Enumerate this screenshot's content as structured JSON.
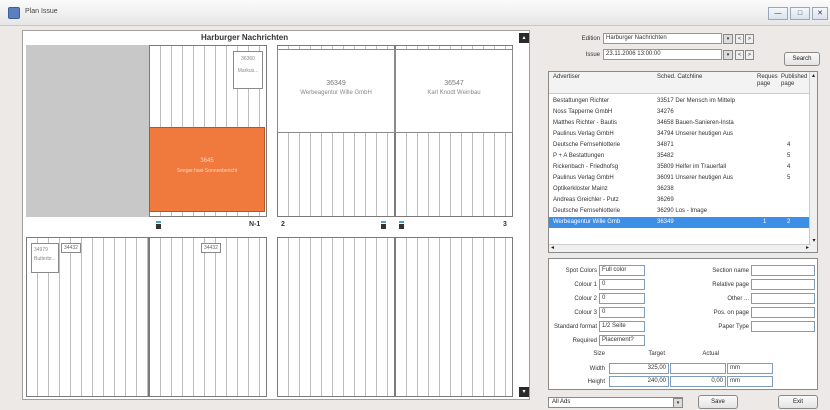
{
  "window": {
    "title": "Plan Issue",
    "controls": [
      "—",
      "□",
      "✕"
    ]
  },
  "layout": {
    "publication": "Harburger Nachrichten",
    "ads": {
      "ad1_num": "36349",
      "ad1_name": "Werbeagentur Wille GmbH",
      "ad2_num": "36547",
      "ad2_name": "Karl Knodt Weinbau",
      "orange_num": "3645",
      "orange_text": "Seeger.hasi-Sonnenbericht",
      "small_top_num": "36360",
      "small_top_text": "Markus...",
      "small_bl1_num": "34979",
      "small_bl1_text": "Butterbr...",
      "small_bl2": "34432",
      "small_bm": "34432"
    },
    "page_labels": {
      "p1": "N-1",
      "p2": "2",
      "p3": "3"
    }
  },
  "filters": {
    "edition_label": "Edition",
    "edition_value": "Harburger Nachrichten",
    "issue_label": "Issue",
    "issue_value": "23.11.2006 13:00:00",
    "search_label": "Search",
    "nav_prev": "<",
    "nav_next": ">",
    "dropdown_glyph": "▾"
  },
  "grid": {
    "headers": {
      "advertiser": "Advertiser",
      "sched": "Sched. Catchline",
      "requested": "Reques page",
      "published": "Published page"
    },
    "rows": [
      {
        "advertiser": "Bestattungen Richter",
        "sched": "33517 Der Mensch im Mittelp",
        "req": "",
        "pub": ""
      },
      {
        "advertiser": "Noss Tapperne GmbH",
        "sched": "34276",
        "req": "",
        "pub": ""
      },
      {
        "advertiser": "Matthes Richter - Bautis",
        "sched": "34658 Bauen-Sanieren-Insta",
        "req": "",
        "pub": ""
      },
      {
        "advertiser": "Paulinus Verlag GmbH",
        "sched": "34794 Unserer heutigen Aus",
        "req": "",
        "pub": ""
      },
      {
        "advertiser": "Deutsche Fernsehlotterie",
        "sched": "34871",
        "req": "",
        "pub": "4"
      },
      {
        "advertiser": "P + A Bestattungen",
        "sched": "35482",
        "req": "",
        "pub": "5"
      },
      {
        "advertiser": "Rickenbach - Friedhofsg",
        "sched": "35809 Helfer im Trauerfall",
        "req": "",
        "pub": "4"
      },
      {
        "advertiser": "Paulinus Verlag GmbH",
        "sched": "36091 Unserer heutigen Aus",
        "req": "",
        "pub": "5"
      },
      {
        "advertiser": "Optikerkloster Mainz",
        "sched": "36238",
        "req": "",
        "pub": ""
      },
      {
        "advertiser": "Andreas Greichler - Putz",
        "sched": "36269",
        "req": "",
        "pub": ""
      },
      {
        "advertiser": "Deutsche Fernsehlotterie",
        "sched": "36290 Los - Image",
        "req": "",
        "pub": ""
      },
      {
        "advertiser": "Werbeagentur Wille Gmb",
        "sched": "36349",
        "req": "1",
        "pub": "2"
      }
    ],
    "scroll_up": "▴",
    "scroll_down": "▾",
    "scroll_left": "◂",
    "scroll_right": "▸"
  },
  "details": {
    "spot_colors_label": "Spot Colors",
    "spot_colors_value": "Full color",
    "colour1_label": "Colour 1",
    "colour1_value": "0",
    "colour2_label": "Colour 2",
    "colour2_value": "0",
    "colour3_label": "Colour 3",
    "colour3_value": "0",
    "standard_format_label": "Standard format",
    "standard_format_value": "1/2 Seite",
    "required_label": "Required",
    "required_value": "Placement?",
    "section_name_label": "Section name",
    "relative_page_label": "Relative page",
    "other_label": "Other ...",
    "pos_on_page_label": "Pos. on page",
    "paper_type_label": "Paper Type",
    "size_label": "Size",
    "target_label": "Target",
    "actual_label": "Actual",
    "width_label": "Width",
    "width_target": "325,00",
    "width_unit": "mm",
    "height_label": "Height",
    "height_target": "240,00",
    "height_actual": "0,00",
    "height_unit": "mm"
  },
  "footer": {
    "filter_value": "All Ads",
    "save_label": "Save",
    "exit_label": "Exit"
  }
}
